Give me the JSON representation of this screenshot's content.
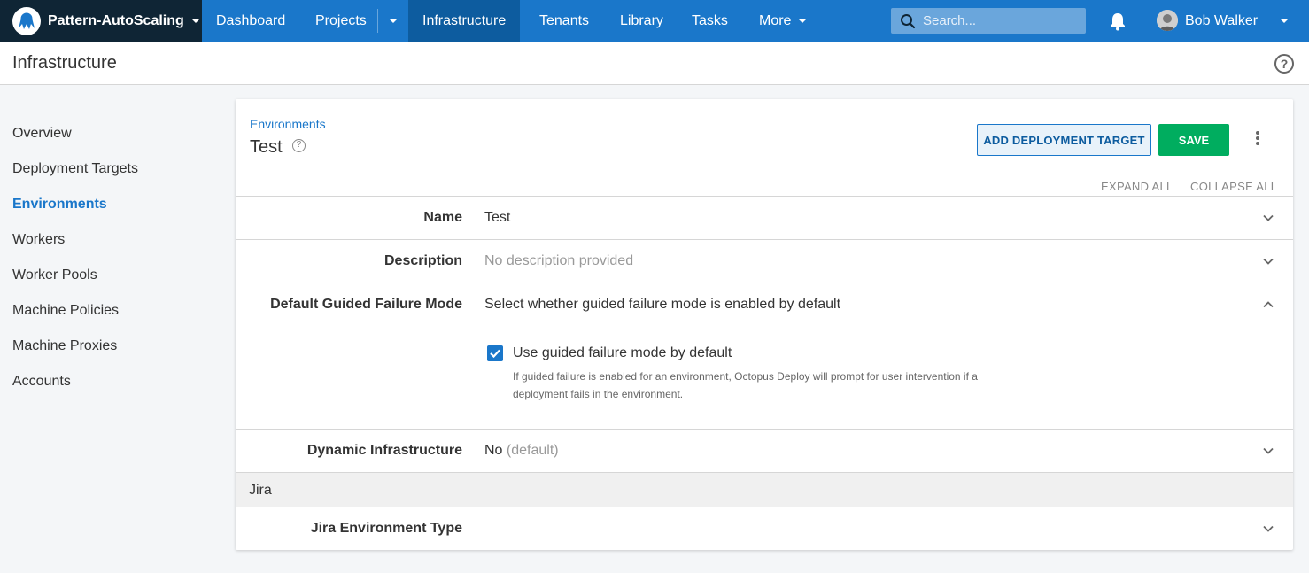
{
  "topnav": {
    "space_name": "Pattern-AutoScaling",
    "items": [
      "Dashboard",
      "Projects",
      "Infrastructure",
      "Tenants",
      "Library",
      "Tasks",
      "More"
    ],
    "active": "Infrastructure",
    "search_placeholder": "Search...",
    "user_name": "Bob Walker",
    "accent_color": "#1a77ca"
  },
  "header": {
    "title": "Infrastructure"
  },
  "sidebar": {
    "items": [
      {
        "label": "Overview"
      },
      {
        "label": "Deployment Targets"
      },
      {
        "label": "Environments",
        "active": true
      },
      {
        "label": "Workers"
      },
      {
        "label": "Worker Pools"
      },
      {
        "label": "Machine Policies"
      },
      {
        "label": "Machine Proxies"
      },
      {
        "label": "Accounts"
      }
    ]
  },
  "card": {
    "breadcrumb": "Environments",
    "title": "Test",
    "add_target_label": "ADD DEPLOYMENT TARGET",
    "save_label": "SAVE",
    "expand_all": "EXPAND ALL",
    "collapse_all": "COLLAPSE ALL",
    "rows": {
      "name": {
        "label": "Name",
        "value": "Test"
      },
      "description": {
        "label": "Description",
        "value": "No description provided"
      },
      "guided_failure": {
        "label": "Default Guided Failure Mode",
        "value": "Select whether guided failure mode is enabled by default",
        "checkbox_label": "Use guided failure mode by default",
        "checkbox_checked": true,
        "help_line1": "If guided failure is enabled for an environment, Octopus Deploy will prompt for user intervention if a",
        "help_line2": "deployment fails in the environment."
      },
      "dynamic": {
        "label": "Dynamic Infrastructure",
        "value": "No",
        "default_note": "(default)"
      },
      "jira_section": "Jira",
      "jira_type": {
        "label": "Jira Environment Type"
      }
    }
  }
}
